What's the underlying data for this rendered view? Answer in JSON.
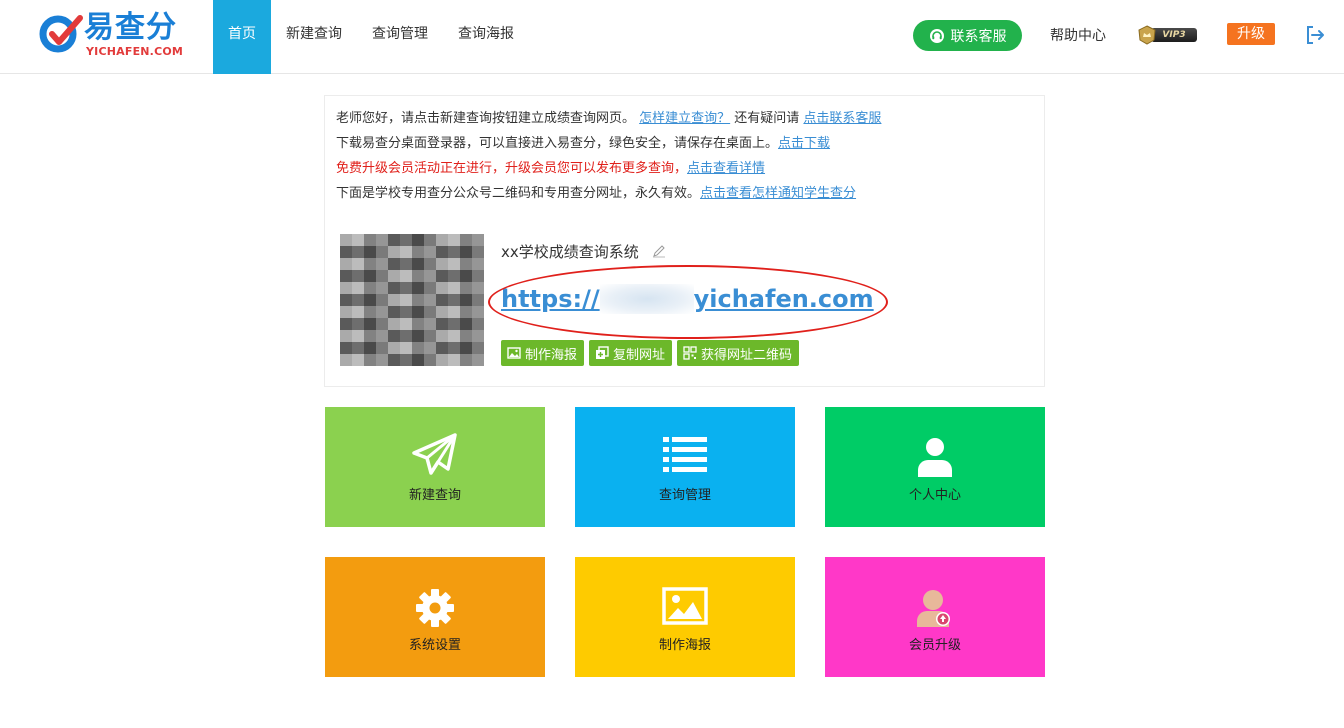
{
  "header": {
    "logo_cn": "易查分",
    "logo_en": "YICHAFEN.COM",
    "nav": [
      "首页",
      "新建查询",
      "查询管理",
      "查询海报"
    ],
    "service_label": "联系客服",
    "help_label": "帮助中心",
    "vip_label": "VIP3",
    "upgrade_label": "升级"
  },
  "info": {
    "line1": {
      "text": "老师您好，请点击新建查询按钮建立成绩查询网页。 ",
      "link1": "怎样建立查询？",
      "mid": " 还有疑问请 ",
      "link2": "点击联系客服"
    },
    "line2": {
      "text": "下载易查分桌面登录器，可以直接进入易查分，绿色安全，请保存在桌面上。",
      "link": "点击下载"
    },
    "line3": {
      "text": "免费升级会员活动正在进行，升级会员您可以发布更多查询，",
      "link": "点击查看详情"
    },
    "line4": {
      "text": "下面是学校专用查分公众号二维码和专用查分网址，永久有效。",
      "link": "点击查看怎样通知学生查分"
    },
    "system_name": "xx学校成绩查询系统",
    "url_prefix": "https://",
    "url_suffix": "yichafen.com",
    "actions": [
      "制作海报",
      "复制网址",
      "获得网址二维码"
    ]
  },
  "tiles": [
    {
      "label": "新建查询",
      "color": "#8bd14f",
      "icon": "paper-plane-icon"
    },
    {
      "label": "查询管理",
      "color": "#0ab1f0",
      "icon": "list-icon"
    },
    {
      "label": "个人中心",
      "color": "#00cc66",
      "icon": "user-icon"
    },
    {
      "label": "系统设置",
      "color": "#f39c0f",
      "icon": "gear-icon"
    },
    {
      "label": "制作海报",
      "color": "#fecb00",
      "icon": "image-icon"
    },
    {
      "label": "会员升级",
      "color": "#ff38c8",
      "icon": "member-upgrade-icon"
    }
  ],
  "colors": {
    "nav_active": "#1ba9de",
    "service_green": "#22b24c",
    "upgrade_orange": "#f5731f",
    "link_blue": "#3a8ed4",
    "alert_red": "#e0201b",
    "action_green": "#6cb82a"
  }
}
